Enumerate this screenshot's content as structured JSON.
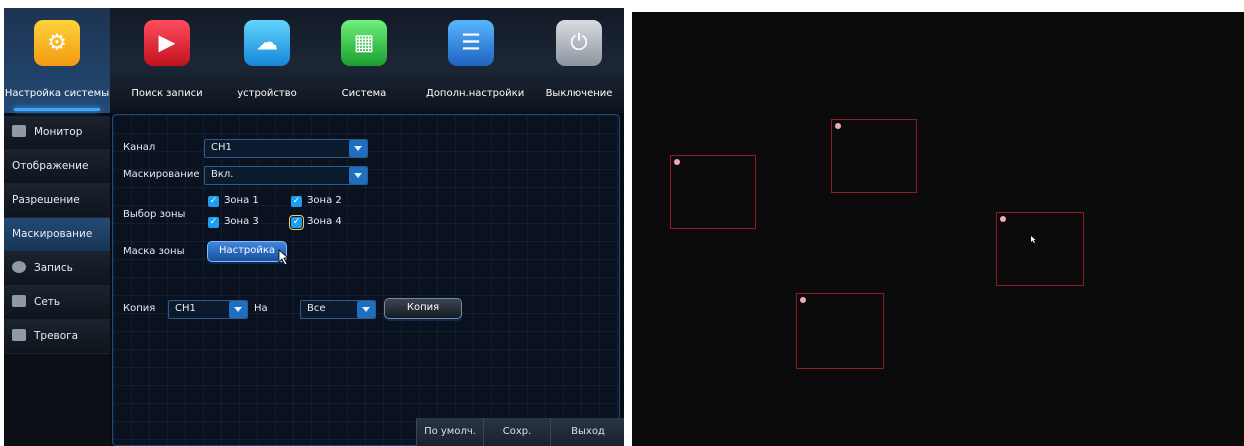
{
  "nav": {
    "items": [
      {
        "label": "Настройка системы",
        "icon": "settings-gears-icon"
      },
      {
        "label": "Поиск записи",
        "icon": "video-search-icon"
      },
      {
        "label": "устройство",
        "icon": "cloud-storage-icon"
      },
      {
        "label": "Система",
        "icon": "system-info-icon"
      },
      {
        "label": "Дополн.настройки",
        "icon": "advanced-settings-icon"
      },
      {
        "label": "Выключение",
        "icon": "power-icon"
      }
    ],
    "active": "Настройка системы"
  },
  "sidebar": {
    "items": [
      {
        "label": "Монитор",
        "icon": "monitor-icon"
      },
      {
        "label": "Отображение"
      },
      {
        "label": "Разрешение"
      },
      {
        "label": "Маскирование"
      },
      {
        "label": "Запись",
        "icon": "record-icon"
      },
      {
        "label": "Сеть",
        "icon": "network-icon"
      },
      {
        "label": "Тревога",
        "icon": "alarm-icon"
      }
    ],
    "active": "Маскирование"
  },
  "form": {
    "channel_label": "Канал",
    "channel_value": "CH1",
    "masking_label": "Маскирование",
    "masking_value": "Вкл.",
    "zone_select_label": "Выбор зоны",
    "zones": [
      "Зона 1",
      "Зона 2",
      "Зона 3",
      "Зона 4"
    ],
    "zone_mask_label": "Маска зоны",
    "setup_button": "Настройка",
    "copy_label": "Копия",
    "copy_from": "CH1",
    "to_label": "На",
    "copy_to": "Все",
    "copy_button": "Копия"
  },
  "footer": {
    "default_button": "По умолч.",
    "save_button": "Сохр.",
    "exit_button": "Выход"
  },
  "colors": {
    "accent": "#1d9ef0",
    "zone_border": "#8a1e22",
    "zone_marker": "#f2a9b6"
  }
}
